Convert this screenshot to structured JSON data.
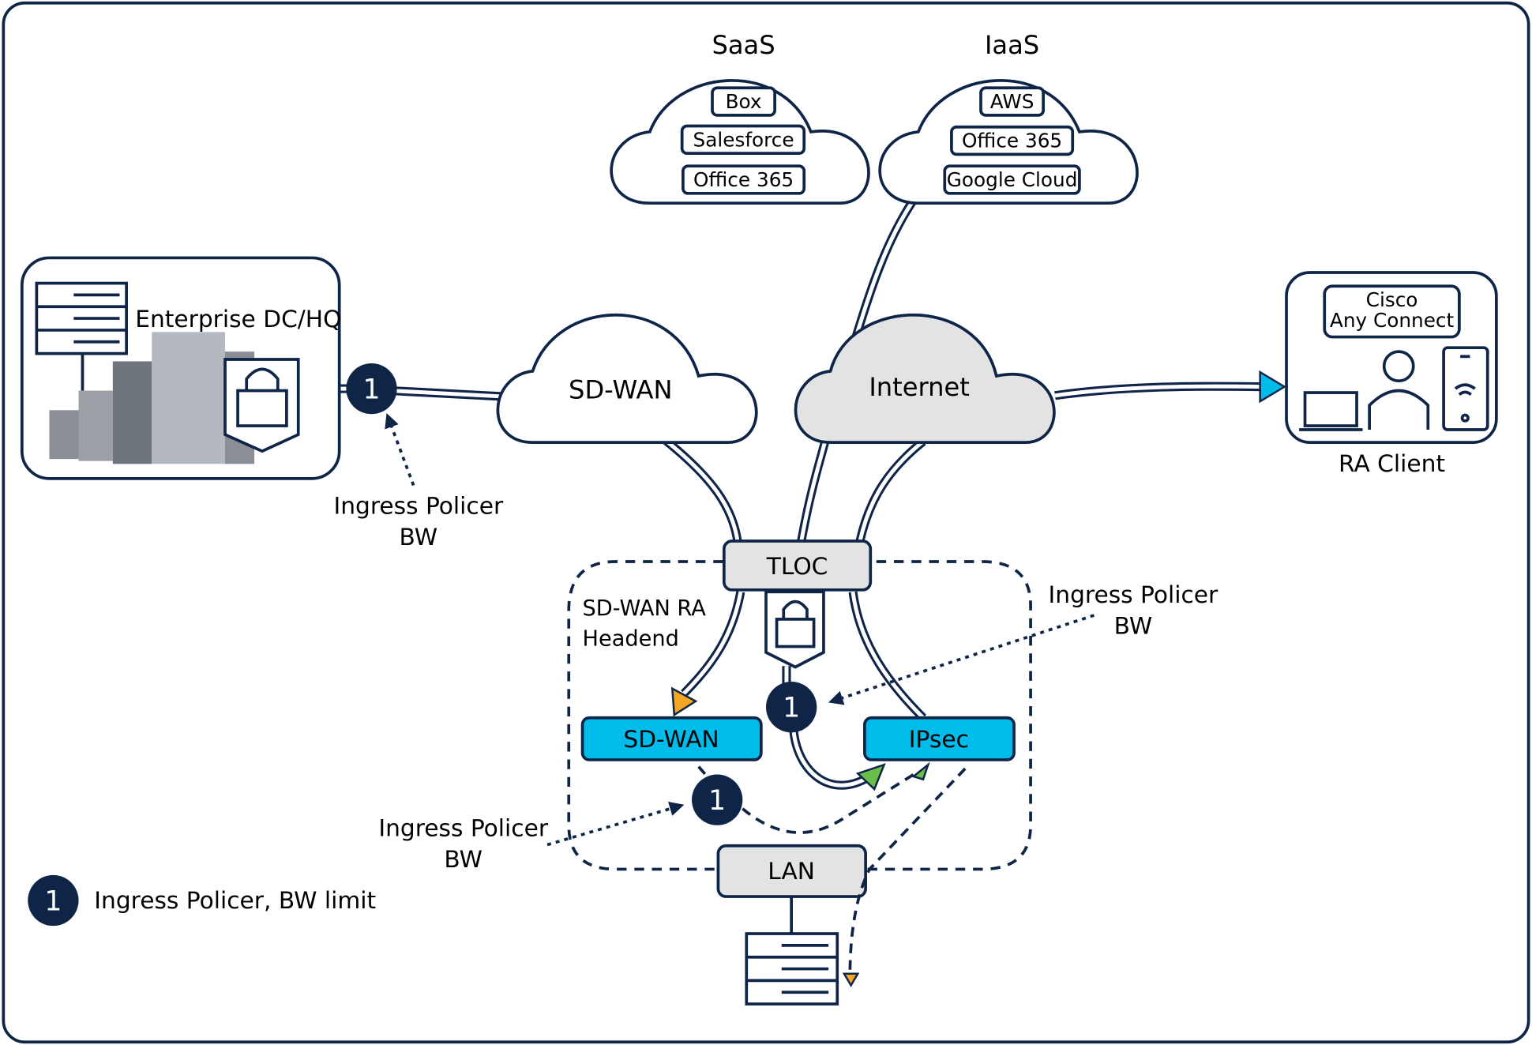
{
  "clouds": {
    "saas": {
      "title": "SaaS",
      "items": [
        "Box",
        "Salesforce",
        "Office 365"
      ]
    },
    "iaas": {
      "title": "IaaS",
      "items": [
        "AWS",
        "Office 365",
        "Google Cloud"
      ]
    },
    "sdwan": "SD-WAN",
    "internet": "Internet"
  },
  "enterprise": {
    "label": "Enterprise DC/HQ"
  },
  "ra_client": {
    "label": "RA Client",
    "app_line1": "Cisco",
    "app_line2": "Any Connect"
  },
  "headend": {
    "label_line1": "SD-WAN RA",
    "label_line2": "Headend",
    "tloc": "TLOC",
    "sdwan_box": "SD-WAN",
    "ipsec_box": "IPsec",
    "lan": "LAN"
  },
  "policer": {
    "badge": "1",
    "line1": "Ingress Policer",
    "line2": "BW"
  },
  "legend": {
    "badge": "1",
    "text": "Ingress Policer, BW limit"
  },
  "colors": {
    "navy": "#0f2548",
    "cyan": "#00bceb",
    "gray": "#e3e3e3",
    "orange": "#f5a623",
    "green": "#6abf4b"
  }
}
